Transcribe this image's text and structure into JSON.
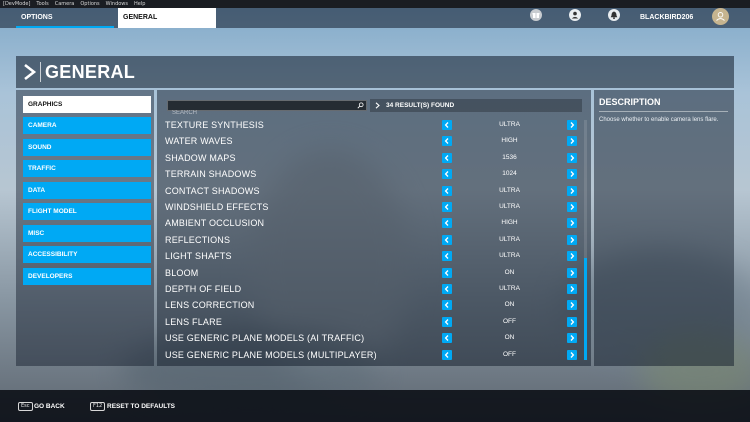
{
  "devbar": [
    "[DevMode]",
    "Tools",
    "Camera",
    "Options",
    "Windows",
    "Help"
  ],
  "tabs": {
    "options": "OPTIONS",
    "general": "GENERAL"
  },
  "user": {
    "name": "BLACKBIRD206"
  },
  "top_icons": [
    "gift-icon",
    "profile-icon",
    "notifications-icon",
    "avatar-icon"
  ],
  "page_title": "GENERAL",
  "sidebar": {
    "items": [
      {
        "label": "GRAPHICS",
        "active": true
      },
      {
        "label": "CAMERA"
      },
      {
        "label": "SOUND"
      },
      {
        "label": "TRAFFIC"
      },
      {
        "label": "DATA"
      },
      {
        "label": "FLIGHT MODEL"
      },
      {
        "label": "MISC"
      },
      {
        "label": "ACCESSIBILITY"
      },
      {
        "label": "DEVELOPERS"
      }
    ]
  },
  "search": {
    "placeholder": "SEARCH",
    "value": ""
  },
  "results_text": "34 RESULT(S) FOUND",
  "settings": [
    {
      "label": "TEXTURE SYNTHESIS",
      "value": "ULTRA"
    },
    {
      "label": "WATER WAVES",
      "value": "HIGH"
    },
    {
      "label": "SHADOW MAPS",
      "value": "1536"
    },
    {
      "label": "TERRAIN SHADOWS",
      "value": "1024"
    },
    {
      "label": "CONTACT SHADOWS",
      "value": "ULTRA"
    },
    {
      "label": "WINDSHIELD EFFECTS",
      "value": "ULTRA"
    },
    {
      "label": "AMBIENT OCCLUSION",
      "value": "HIGH"
    },
    {
      "label": "REFLECTIONS",
      "value": "ULTRA"
    },
    {
      "label": "LIGHT SHAFTS",
      "value": "ULTRA"
    },
    {
      "label": "BLOOM",
      "value": "ON"
    },
    {
      "label": "DEPTH OF FIELD",
      "value": "ULTRA"
    },
    {
      "label": "LENS CORRECTION",
      "value": "ON"
    },
    {
      "label": "LENS FLARE",
      "value": "OFF"
    },
    {
      "label": "USE GENERIC PLANE MODELS (AI TRAFFIC)",
      "value": "ON"
    },
    {
      "label": "USE GENERIC PLANE MODELS (MULTIPLAYER)",
      "value": "OFF"
    }
  ],
  "description": {
    "title": "DESCRIPTION",
    "text": "Choose whether to enable camera lens flare."
  },
  "bottom": {
    "back_key": "Esc",
    "back_label": "GO BACK",
    "reset_key": "F12",
    "reset_label": "RESET TO DEFAULTS"
  },
  "colors": {
    "accent": "#00a9f4",
    "panel": "#0f1928",
    "active_tab": "#ffffff"
  }
}
